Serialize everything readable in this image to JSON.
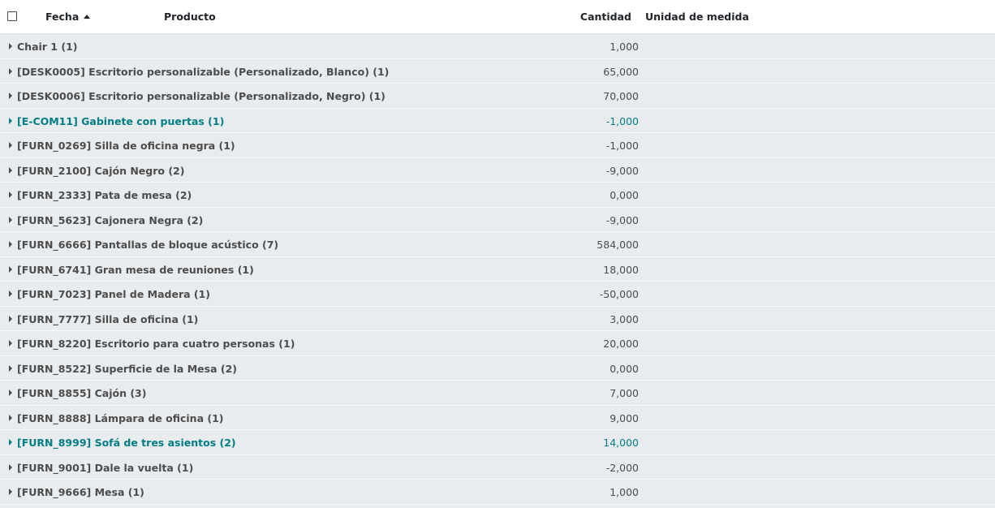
{
  "header": {
    "fecha": "Fecha",
    "producto": "Producto",
    "cantidad": "Cantidad",
    "unidad": "Unidad de medida"
  },
  "colors": {
    "accent": "#017e84",
    "group_text": "#4c4c4c",
    "group_background": "#e9ecef"
  },
  "groups": [
    {
      "label": "Chair 1 (1)",
      "qty": "1,000"
    },
    {
      "label": "[DESK0005] Escritorio personalizable (Personalizado, Blanco) (1)",
      "qty": "65,000"
    },
    {
      "label": "[DESK0006] Escritorio personalizable (Personalizado, Negro) (1)",
      "qty": "70,000"
    },
    {
      "label": "[E-COM11] Gabinete con puertas (1)",
      "qty": "-1,000"
    },
    {
      "label": "[FURN_0269] Silla de oficina negra (1)",
      "qty": "-1,000"
    },
    {
      "label": "[FURN_2100] Cajón Negro (2)",
      "qty": "-9,000"
    },
    {
      "label": "[FURN_2333] Pata de mesa (2)",
      "qty": "0,000"
    },
    {
      "label": "[FURN_5623] Cajonera Negra (2)",
      "qty": "-9,000"
    },
    {
      "label": "[FURN_6666] Pantallas de bloque acústico (7)",
      "qty": "584,000"
    },
    {
      "label": "[FURN_6741] Gran mesa de reuniones (1)",
      "qty": "18,000"
    },
    {
      "label": "[FURN_7023] Panel de Madera (1)",
      "qty": "-50,000"
    },
    {
      "label": "[FURN_7777] Silla de oficina (1)",
      "qty": "3,000"
    },
    {
      "label": "[FURN_8220] Escritorio para cuatro personas (1)",
      "qty": "20,000"
    },
    {
      "label": "[FURN_8522] Superficie de la Mesa (2)",
      "qty": "0,000"
    },
    {
      "label": "[FURN_8855] Cajón (3)",
      "qty": "7,000"
    },
    {
      "label": "[FURN_8888] Lámpara de oficina (1)",
      "qty": "9,000"
    },
    {
      "label": "[FURN_8999] Sofá de tres asientos (2)",
      "qty": "14,000"
    },
    {
      "label": "[FURN_9001] Dale la vuelta (1)",
      "qty": "-2,000"
    },
    {
      "label": "[FURN_9666] Mesa (1)",
      "qty": "1,000"
    }
  ]
}
